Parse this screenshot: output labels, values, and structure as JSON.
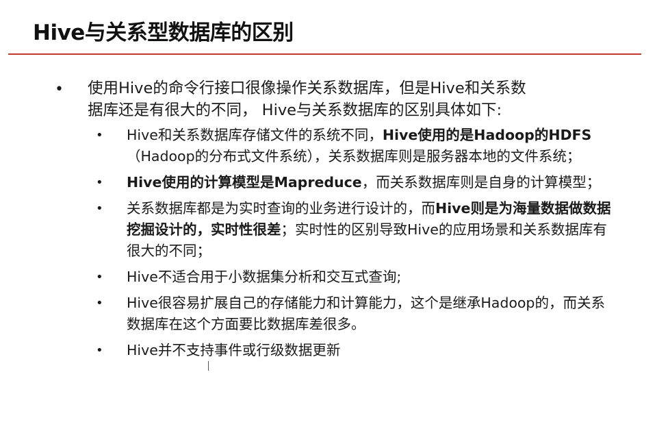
{
  "slide": {
    "title": "Hive与关系型数据库的区别",
    "main_bullet": {
      "marker": "•",
      "line1": "使用Hive的命令行接口很像操作关系数据库，但是Hive和关系数",
      "line2": "据库还是有很大的不同， Hive与关系数据库的区别具体如下:"
    },
    "sub_bullets": [
      {
        "marker": "•",
        "p1": "Hive和关系数据库存储文件的系统不同，",
        "p2_bold": "Hive使用的是Hadoop的HDFS",
        "p3": "（Hadoop的分布式文件系统），关系数据库则是服务器本地的文件系统；"
      },
      {
        "marker": "•",
        "p1_bold": "Hive使用的计算模型是Mapreduce",
        "p2": "，而关系数据库则是自身的计算模型；"
      },
      {
        "marker": "•",
        "p1": "关系数据库都是为实时查询的业务进行设计的，而",
        "p2_bold": "Hive则是为海量数据做数据挖掘设计的，实时性很差",
        "p3": "；实时性的区别导致Hive的应用场景和关系数据库有很大的不同；"
      },
      {
        "marker": "•",
        "p1": "Hive不适合用于小数据集分析和交互式查询;"
      },
      {
        "marker": "•",
        "p1": "Hive很容易扩展自己的存储能力和计算能力，这个是继承Hadoop的，而关系数据库在这个方面要比数据库差很多。"
      },
      {
        "marker": "•",
        "p1": "Hive并不支持事件或行级数据更新"
      }
    ],
    "colors": {
      "rule": "#c0392b",
      "text": "#1a1a1a",
      "background": "#ffffff"
    }
  }
}
